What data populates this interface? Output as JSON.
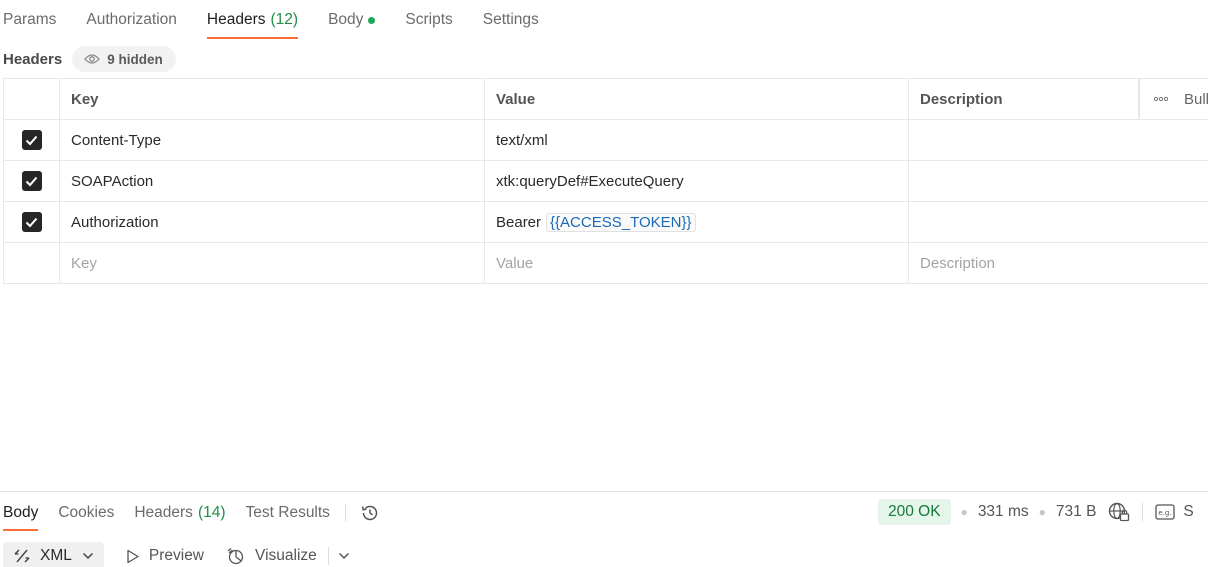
{
  "top_tabs": [
    {
      "label": "Params"
    },
    {
      "label": "Authorization"
    },
    {
      "label": "Headers",
      "count": "(12)"
    },
    {
      "label": "Body"
    },
    {
      "label": "Scripts"
    },
    {
      "label": "Settings"
    }
  ],
  "headers_section": {
    "title": "Headers",
    "hidden_label": "9 hidden"
  },
  "table": {
    "columns": {
      "key": "Key",
      "value": "Value",
      "description": "Description",
      "bulk": "Bull"
    },
    "rows": [
      {
        "key": "Content-Type",
        "value": "text/xml",
        "description": ""
      },
      {
        "key": "SOAPAction",
        "value": "xtk:queryDef#ExecuteQuery",
        "description": ""
      },
      {
        "key": "Authorization",
        "value_prefix": "Bearer",
        "value_variable": "{{ACCESS_TOKEN}}",
        "description": ""
      }
    ],
    "placeholders": {
      "key": "Key",
      "value": "Value",
      "description": "Description"
    }
  },
  "response_tabs": [
    {
      "label": "Body"
    },
    {
      "label": "Cookies"
    },
    {
      "label": "Headers",
      "count": "(14)"
    },
    {
      "label": "Test Results"
    }
  ],
  "status": {
    "code": "200 OK",
    "time": "331 ms",
    "size": "731 B",
    "trailing": "S"
  },
  "toolbar": {
    "format": "XML",
    "preview": "Preview",
    "visualize": "Visualize"
  },
  "colors": {
    "accent": "#ff6c37",
    "success": "#1ea85b",
    "variable": "#1a6ab4"
  }
}
